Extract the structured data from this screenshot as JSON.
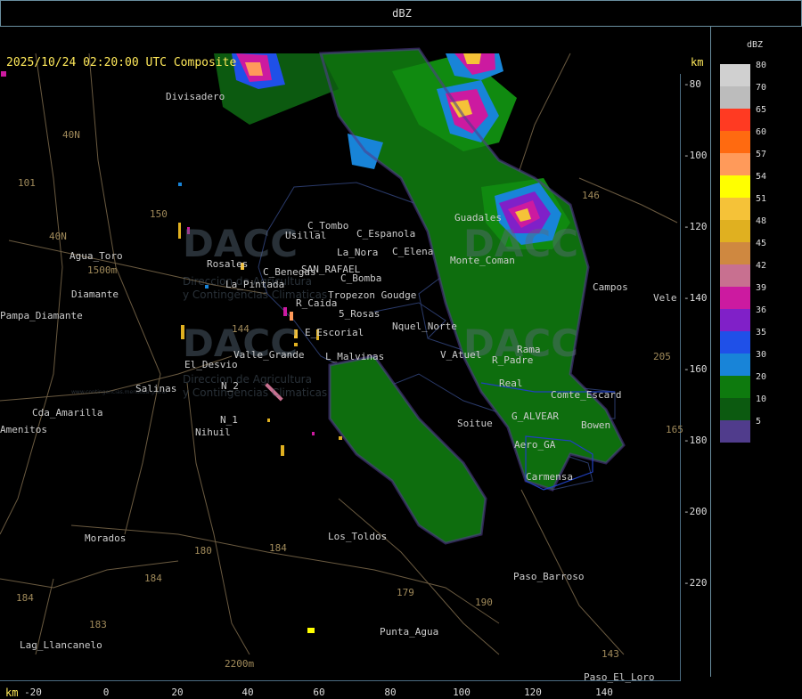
{
  "window": {
    "title": "dBZ"
  },
  "map": {
    "header": "2025/10/24 02:20:00 UTC Composite",
    "km_top": "km",
    "km_bottom": "km",
    "y_ticks": [
      "-80",
      "-100",
      "-120",
      "-140",
      "-160",
      "-180",
      "-200",
      "-220"
    ],
    "x_ticks": [
      "-20",
      "0",
      "20",
      "40",
      "60",
      "80",
      "100",
      "120",
      "140"
    ],
    "places": [
      "Divisadero",
      "Agua_Toro",
      "Pampa_Diamante",
      "Cda_Amarilla",
      "Salinas",
      "El_Desvio",
      "Valle_Grande",
      "N_1",
      "N_2",
      "Nihuil",
      "Morados",
      "Los_Toldos",
      "Punta_Agua",
      "Lag_Llancanelo",
      "Paso_Barroso",
      "Paso_El_Loro",
      "Guadales",
      "Usillal",
      "C_Tombo",
      "C_Espanola",
      "La_Nora",
      "C_Elena",
      "Rosales",
      "La_Pintada",
      "C_Benegas",
      "SAN_RAFAEL",
      "R_Caida",
      "C_Bomba",
      "Tropezon Goudge",
      "5_Rosas",
      "E_Escorial",
      "L_Malvinas",
      "Nquel_Norte",
      "V_Atuel",
      "R_Padre",
      "Soitue",
      "G_ALVEAR",
      "Aero_GA",
      "Bowen",
      "Carmensa",
      "Comte_Escard",
      "Monte_Coman",
      "Campos",
      "Vele",
      "Diamante",
      "Amenitos",
      "Rama",
      "Real"
    ],
    "route_labels": [
      "40N",
      "101",
      "150",
      "40N",
      "144",
      "146",
      "179",
      "180",
      "184",
      "184",
      "183",
      "184",
      "190",
      "143",
      "205",
      "165"
    ],
    "elevations": [
      "1500m",
      "2200m"
    ],
    "watermark_words": [
      "DACC",
      "Direccion de Agricultura",
      "y Contingencias Climaticas",
      "www.contingencias.mendoza.gov.ar"
    ]
  },
  "legend": {
    "title": "dBZ",
    "levels": [
      {
        "value": "80",
        "color": "#d0d0d0"
      },
      {
        "value": "70",
        "color": "#bcbcbc"
      },
      {
        "value": "65",
        "color": "#ff3a22"
      },
      {
        "value": "60",
        "color": "#ff6a10"
      },
      {
        "value": "57",
        "color": "#ff9a5a"
      },
      {
        "value": "54",
        "color": "#ffff00"
      },
      {
        "value": "51",
        "color": "#f5c238"
      },
      {
        "value": "48",
        "color": "#e0b020"
      },
      {
        "value": "45",
        "color": "#cf8840"
      },
      {
        "value": "42",
        "color": "#c87090"
      },
      {
        "value": "39",
        "color": "#cc1aa0"
      },
      {
        "value": "36",
        "color": "#8020c8"
      },
      {
        "value": "35",
        "color": "#1f50e8"
      },
      {
        "value": "30",
        "color": "#1884d8"
      },
      {
        "value": "20",
        "color": "#0e7a0e"
      },
      {
        "value": "10",
        "color": "#0c5a10"
      },
      {
        "value": "5",
        "color": "#503c8c"
      }
    ]
  }
}
